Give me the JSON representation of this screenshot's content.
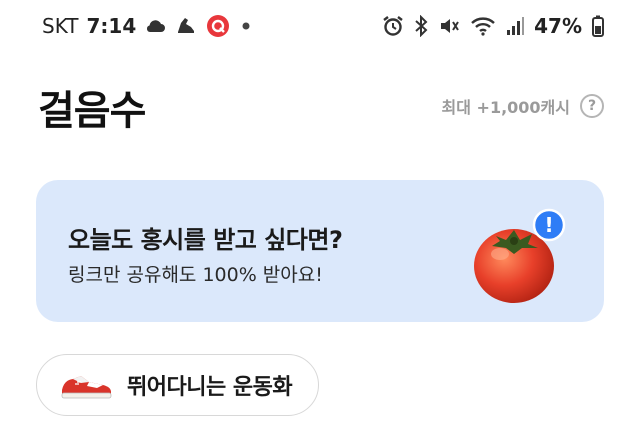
{
  "status_bar": {
    "carrier": "SKT",
    "time": "7:14",
    "battery": "47%",
    "left_icons": [
      "cloud-icon",
      "shoe-notification-icon",
      "record-icon",
      "dot-icon"
    ],
    "right_icons": [
      "alarm-icon",
      "bluetooth-icon",
      "mute-icon",
      "wifi-icon",
      "signal-icon",
      "battery-icon"
    ]
  },
  "header": {
    "title": "걸음수",
    "max_cash": "최대 +1,000캐시",
    "help_symbol": "?"
  },
  "banner": {
    "title": "오늘도 홍시를 받고 싶다면?",
    "subtitle": "링크만 공유해도 100% 받아요!",
    "badge_symbol": "!",
    "image": "persimmon-icon"
  },
  "chip": {
    "label": "뛰어다니는 운동화",
    "icon": "sneaker-icon"
  },
  "colors": {
    "banner_bg": "#dbe8fb",
    "badge_blue": "#2f7df6",
    "persimmon": "#e8402a",
    "record_red": "#e8373c"
  }
}
